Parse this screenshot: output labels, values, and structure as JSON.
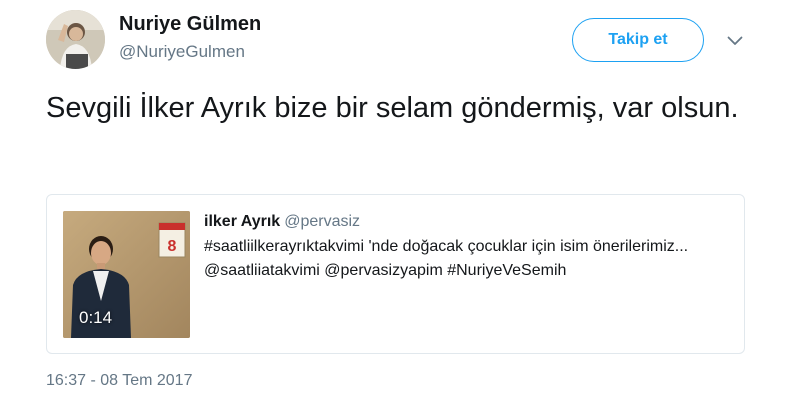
{
  "author": {
    "name": "Nuriye Gülmen",
    "handle": "@NuriyeGulmen",
    "avatar_icon": "profile-photo"
  },
  "actions": {
    "follow_label": "Takip et",
    "menu_icon": "chevron-down-icon"
  },
  "tweet": {
    "text": "Sevgili İlker Ayrık bize bir selam göndermiş, var olsun."
  },
  "quoted": {
    "name": "ilker Ayrık",
    "handle": "@pervasiz",
    "text": "#saatliilkerayrıktakvimi 'nde doğacak çocuklar için isim önerilerimiz... @saatliiatakvimi @pervasizyapim #NuriyeVeSemih",
    "media": {
      "duration": "0:14",
      "calendar_day": "8"
    }
  },
  "timestamp": "16:37 - 08 Tem 2017",
  "colors": {
    "accent": "#1da1f2",
    "secondary_text": "#657786",
    "border": "#e1e8ed"
  }
}
